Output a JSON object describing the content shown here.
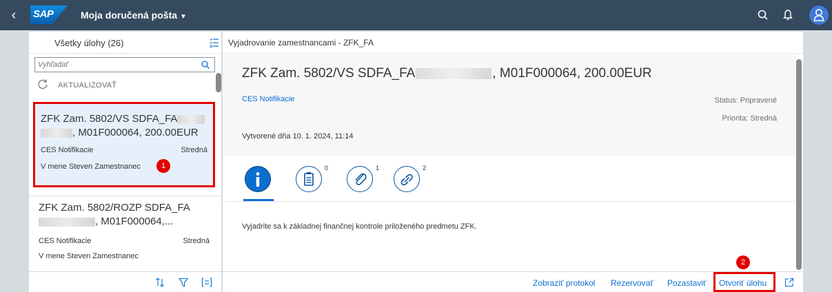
{
  "shell": {
    "title": "Moja doručená pošta",
    "caret": "▼",
    "logo": "SAP",
    "avatar_glyph": "8"
  },
  "master": {
    "title": "Všetky úlohy (26)",
    "search_placeholder": "Vyhľadať",
    "refresh_label": "AKTUALIZOVAŤ",
    "items": [
      {
        "title_line1": "ZFK Zam. 5802/VS SDFA_FA",
        "title_line2": ", M01F000064, 200.00EUR",
        "category": "CES Notifikacie",
        "priority": "Stredná",
        "created_by": "V mene Steven Zamestnanec",
        "badge": "1"
      },
      {
        "title_line1": "ZFK Zam. 5802/ROZP SDFA_FA",
        "title_line2": ", M01F000064,...",
        "category": "CES Notifikacie",
        "priority": "Stredná",
        "created_by": "V mene Steven Zamestnanec"
      }
    ]
  },
  "detail": {
    "header": "Vyjadrovanie zamestnancami - ZFK_FA",
    "title_part1": "ZFK Zam. 5802/VS SDFA_FA",
    "title_part2": ", M01F000064, 200.00EUR",
    "category_link": "CES Notifikacie",
    "status": "Status: Pripravené",
    "priority": "Priorita: Stredná",
    "created": "Vytvorené dňa 10. 1. 2024, 11:14",
    "tab_counts": {
      "notes": "0",
      "attachments": "1",
      "links": "2"
    },
    "description": "Vyjadrite sa k základnej finančnej kontrole priloženého predmetu ZFK."
  },
  "footer": {
    "show_log": "Zobraziť protokol",
    "reserve": "Rezervovať",
    "pause": "Pozastaviť",
    "open_task": "Otvoriť úlohu",
    "badge": "2"
  },
  "colors": {
    "shell_bg": "#354a5f",
    "accent": "#0a6ed1",
    "highlight_red": "#e30000",
    "selected_bg": "#e5f0fa"
  }
}
